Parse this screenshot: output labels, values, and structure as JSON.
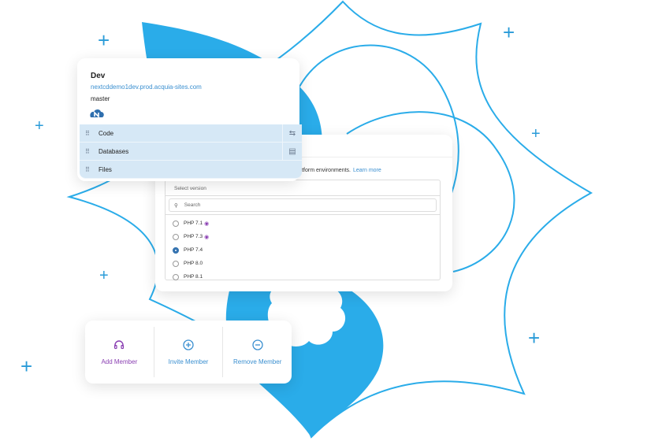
{
  "colors": {
    "brand_blue": "#2aace9",
    "link": "#3a8fd0",
    "purple": "#8a3fb2"
  },
  "environment": {
    "title": "Dev",
    "url": "nextcddemo1dev.prod.acquia-sites.com",
    "branch": "master",
    "logo_icon": "acquia-cloud-logo-icon",
    "rows": [
      {
        "label": "Code",
        "action_icon": "switch-arrows-icon"
      },
      {
        "label": "Databases",
        "action_icon": "database-copy-icon"
      },
      {
        "label": "Files"
      }
    ]
  },
  "php": {
    "description": "Platform environments.",
    "learn_more": "Learn more",
    "select_label": "Select version",
    "search_placeholder": "Search",
    "options": [
      {
        "label": "PHP 7.1",
        "badge": "support-icon",
        "selected": false
      },
      {
        "label": "PHP 7.3",
        "badge": "support-icon",
        "selected": false
      },
      {
        "label": "PHP 7.4",
        "selected": true
      },
      {
        "label": "PHP 8.0",
        "selected": false
      },
      {
        "label": "PHP 8.1",
        "selected": false
      }
    ]
  },
  "members": {
    "add": "Add Member",
    "invite": "Invite Member",
    "remove": "Remove Member"
  }
}
